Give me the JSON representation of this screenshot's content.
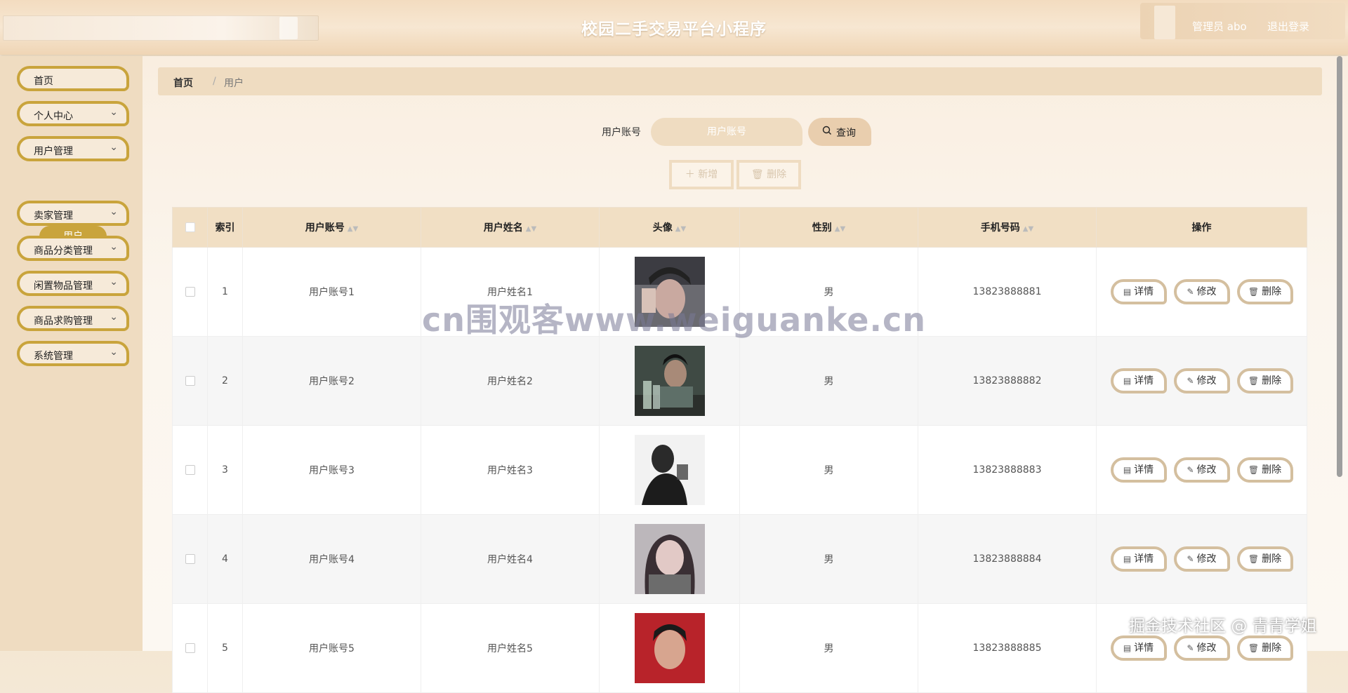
{
  "header": {
    "title": "校园二手交易平台小程序",
    "user": "管理员 abo",
    "logout": "退出登录"
  },
  "sidebar": {
    "items": [
      {
        "label": "首页",
        "has_chevron": false
      },
      {
        "label": "个人中心",
        "has_chevron": true
      },
      {
        "label": "用户管理",
        "has_chevron": true
      },
      {
        "label": "卖家管理",
        "has_chevron": true
      },
      {
        "label": "商品分类管理",
        "has_chevron": true
      },
      {
        "label": "闲置物品管理",
        "has_chevron": true
      },
      {
        "label": "商品求购管理",
        "has_chevron": true
      },
      {
        "label": "系统管理",
        "has_chevron": true
      }
    ],
    "active_sub": "用户"
  },
  "breadcrumb": {
    "home": "首页",
    "separator": "/",
    "current": "用户"
  },
  "search": {
    "label": "用户账号",
    "placeholder": "用户账号",
    "button": "查询"
  },
  "actions": {
    "add": "新增",
    "delete": "删除"
  },
  "table": {
    "columns": [
      "索引",
      "用户账号",
      "用户姓名",
      "头像",
      "性别",
      "手机号码",
      "操作"
    ],
    "row_buttons": {
      "detail": "详情",
      "edit": "修改",
      "delete": "删除"
    },
    "rows": [
      {
        "index": "1",
        "account": "用户账号1",
        "name": "用户姓名1",
        "gender": "男",
        "phone": "13823888881"
      },
      {
        "index": "2",
        "account": "用户账号2",
        "name": "用户姓名2",
        "gender": "男",
        "phone": "13823888882"
      },
      {
        "index": "3",
        "account": "用户账号3",
        "name": "用户姓名3",
        "gender": "男",
        "phone": "13823888883"
      },
      {
        "index": "4",
        "account": "用户账号4",
        "name": "用户姓名4",
        "gender": "男",
        "phone": "13823888884"
      },
      {
        "index": "5",
        "account": "用户账号5",
        "name": "用户姓名5",
        "gender": "男",
        "phone": "13823888885"
      }
    ]
  },
  "watermarks": {
    "center": "cn围观客www.weiguanke.cn",
    "corner": "掘金技术社区 @ 青青学姐"
  },
  "colors": {
    "accent": "#c9a43c",
    "sidebar_bg": "#efdcc1",
    "header_bg": "#f3dcc0",
    "table_header_bg": "#f1dfc4"
  }
}
